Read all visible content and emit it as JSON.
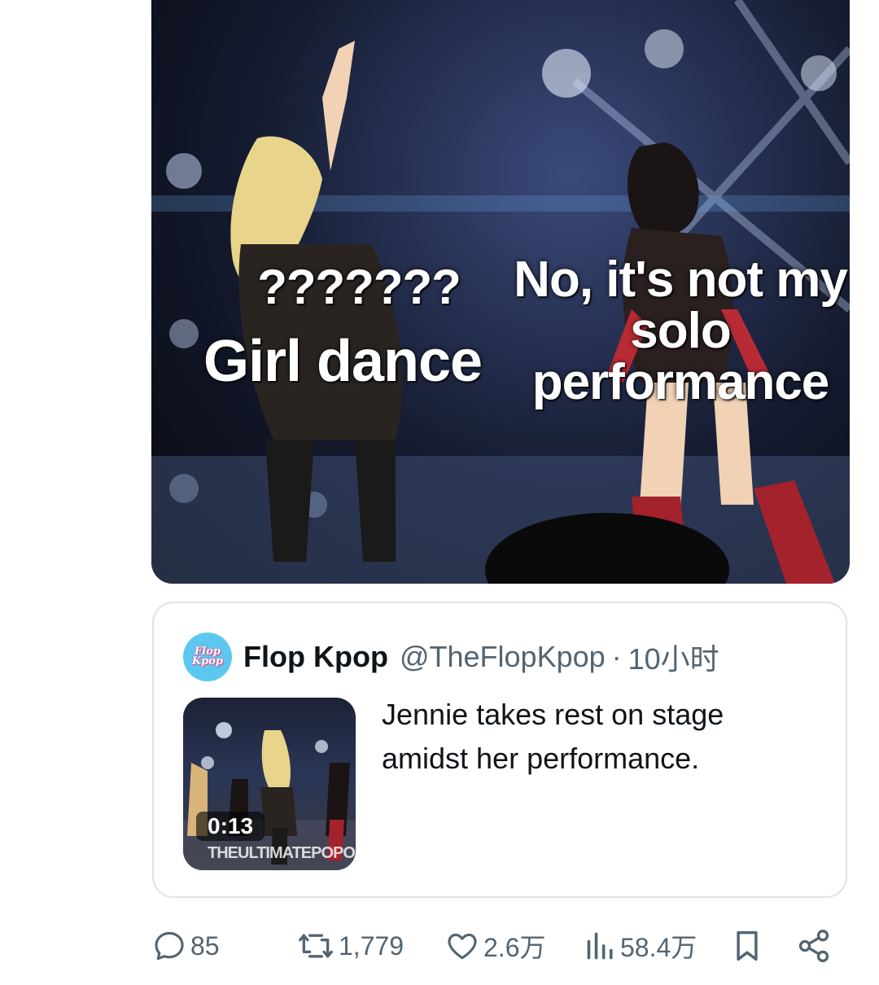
{
  "media": {
    "meme_left_top": "???????",
    "meme_left_bottom": "Girl dance",
    "meme_right": "No, it's not my solo performance"
  },
  "quote": {
    "avatar_text_line1": "Flop",
    "avatar_text_line2": "Kpop",
    "name": "Flop Kpop",
    "handle": "@TheFlopKpop",
    "separator": "·",
    "time": "10小时",
    "text": "Jennie takes rest on stage amidst her performance.",
    "video_duration": "0:13",
    "video_watermark": "THEULTIMATEPOPO"
  },
  "actions": {
    "reply_count": "85",
    "retweet_count": "1,779",
    "like_count": "2.6万",
    "views_count": "58.4万"
  },
  "icons": {
    "reply": "reply-icon",
    "retweet": "retweet-icon",
    "like": "heart-icon",
    "views": "views-icon",
    "bookmark": "bookmark-icon",
    "share": "share-icon"
  },
  "colors": {
    "text_primary": "#0f1419",
    "text_secondary": "#536471",
    "border": "#dfe3e6",
    "avatar_bg": "#5cc8f0"
  }
}
